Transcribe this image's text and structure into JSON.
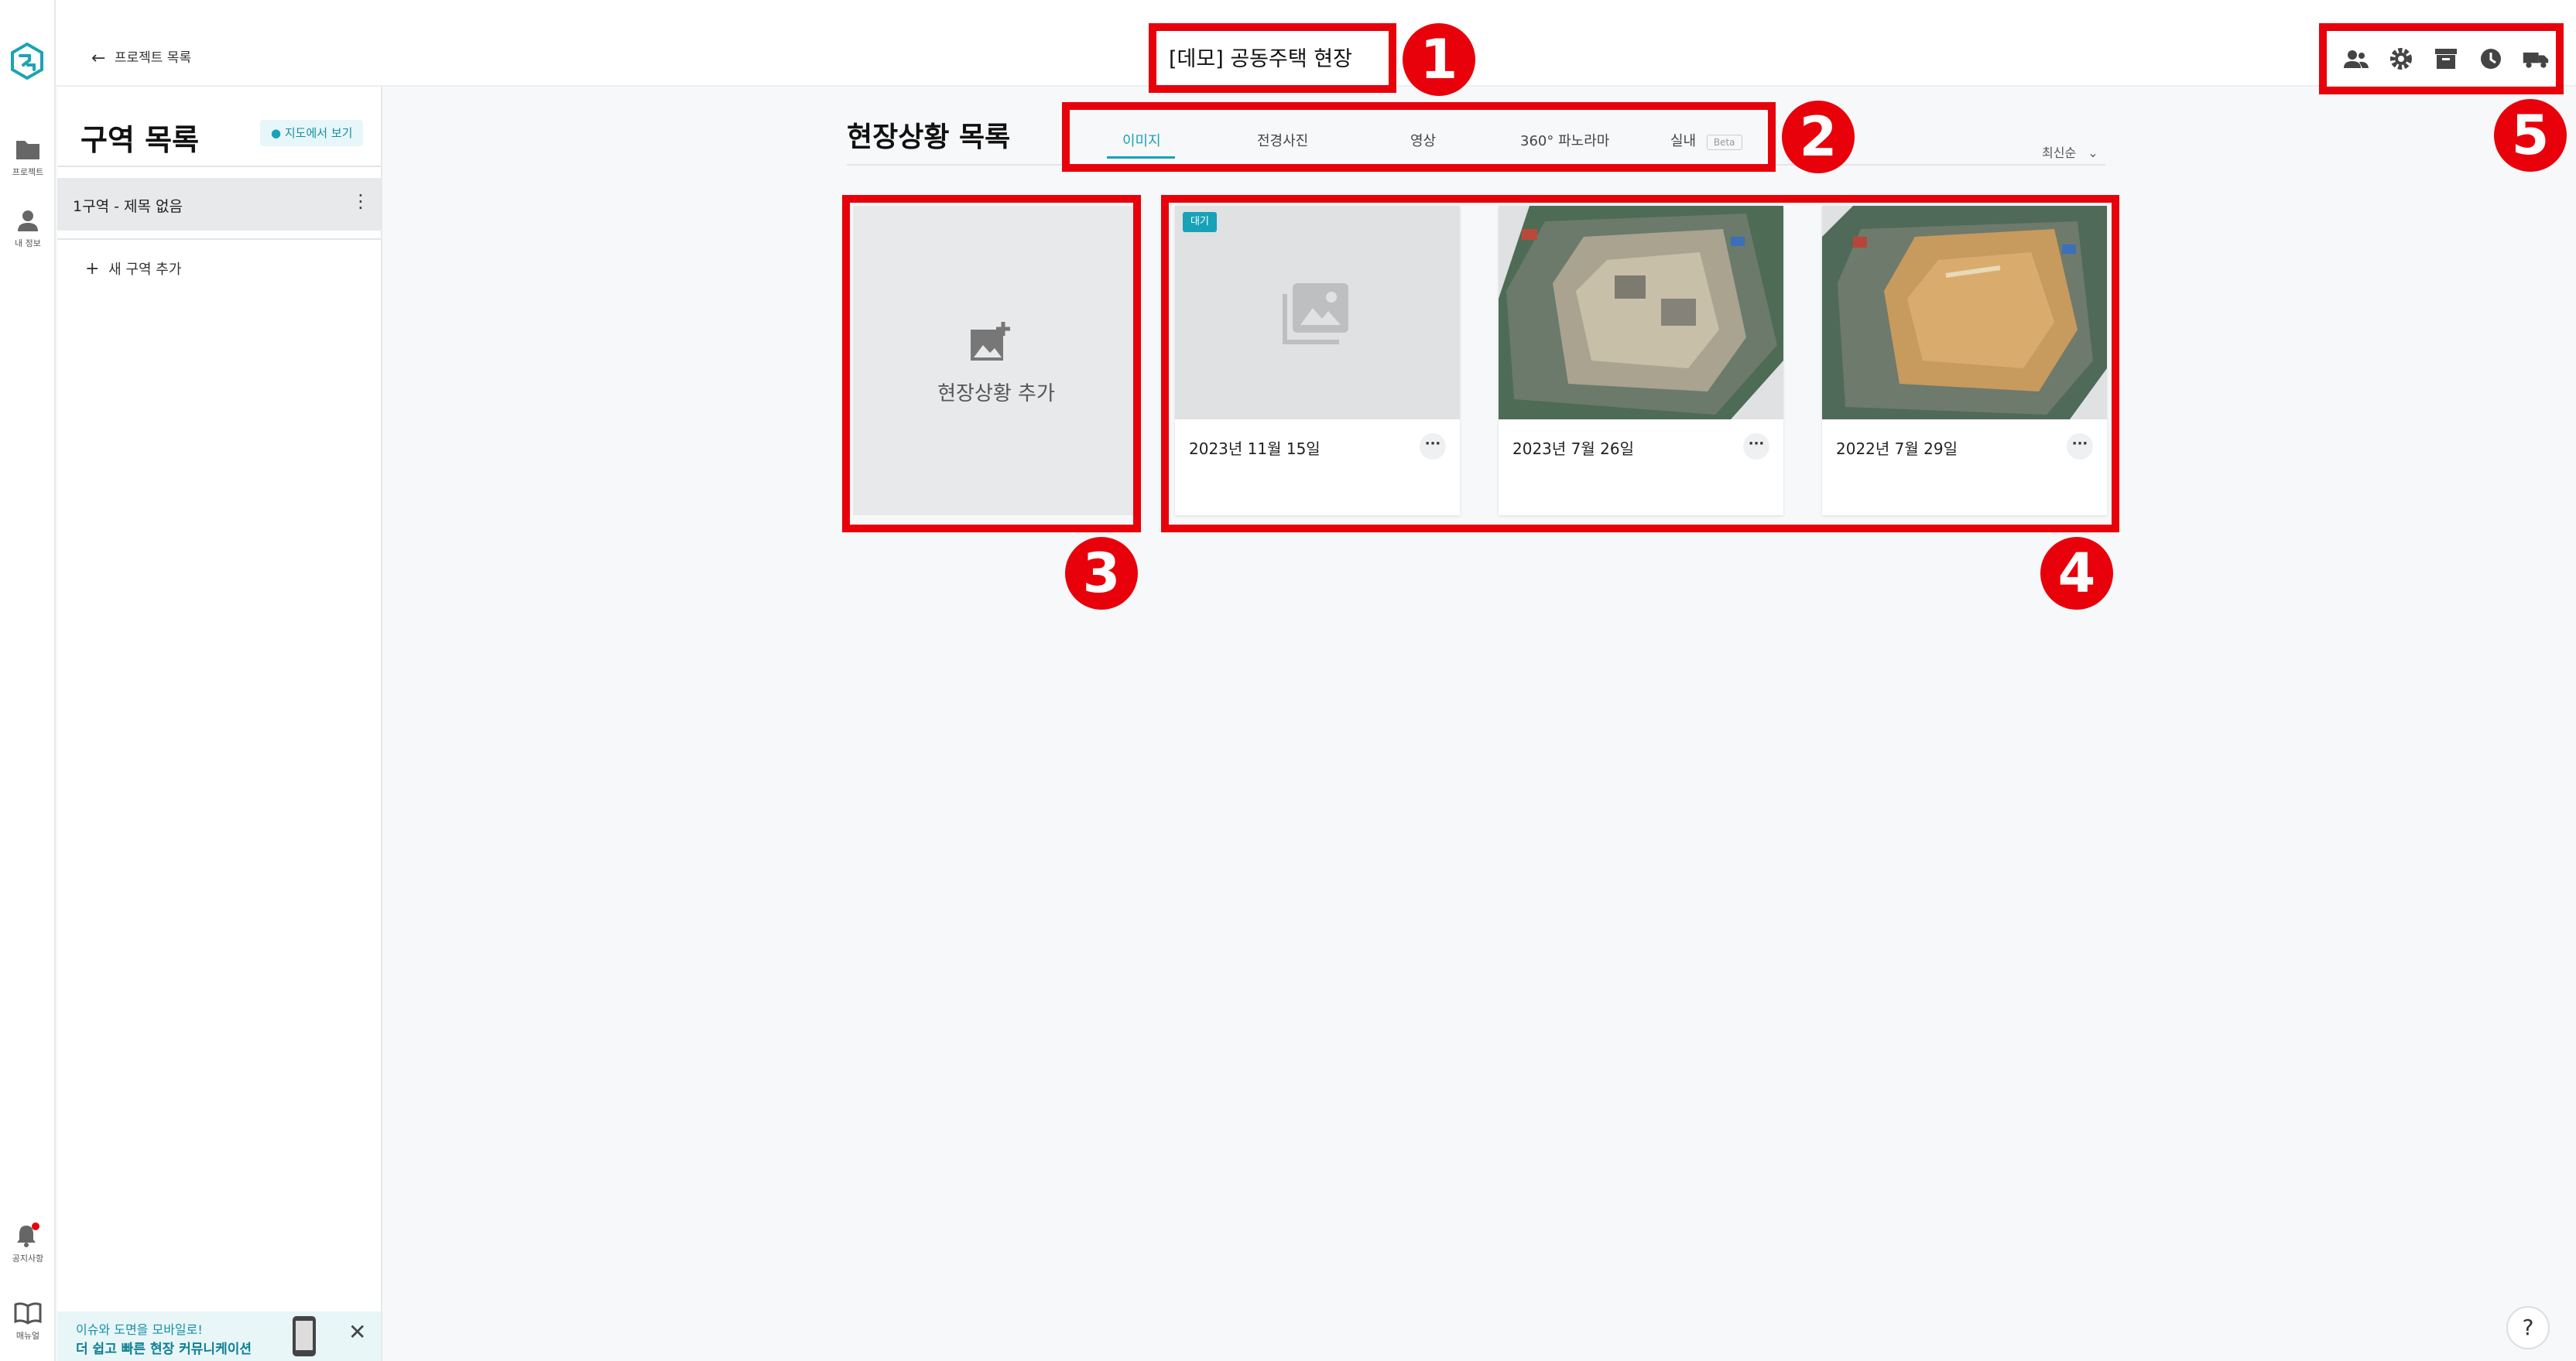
{
  "header": {
    "back_label": "프로젝트 목록",
    "project_title": "[데모] 공동주택 현장"
  },
  "rail": {
    "items": [
      {
        "label": "프로젝트",
        "icon": "folder-icon"
      },
      {
        "label": "내 정보",
        "icon": "person-icon"
      },
      {
        "label": "공지사항",
        "icon": "bell-icon"
      },
      {
        "label": "매뉴얼",
        "icon": "book-icon"
      }
    ]
  },
  "sidebar": {
    "title": "구역 목록",
    "map_button": "지도에서 보기",
    "zones": [
      {
        "label": "1구역 - 제목 없음"
      }
    ],
    "add_zone": "새 구역 추가",
    "promo": {
      "line1": "이슈와 도면을 모바일로!",
      "line2": "더 쉽고 빠른 현장 커뮤니케이션"
    }
  },
  "main": {
    "title": "현장상황 목록",
    "tabs": [
      {
        "label": "이미지",
        "active": true
      },
      {
        "label": "전경사진",
        "active": false
      },
      {
        "label": "영상",
        "active": false
      },
      {
        "label": "360° 파노라마",
        "active": false
      },
      {
        "label": "실내",
        "active": false,
        "badge": "Beta"
      }
    ],
    "sort": "최신순",
    "add_card_label": "현장상황 추가",
    "cards": [
      {
        "date": "2023년 11월 15일",
        "badge": "대기",
        "placeholder": true
      },
      {
        "date": "2023년 7월 26일",
        "badge": "",
        "placeholder": false
      },
      {
        "date": "2022년 7월 29일",
        "badge": "",
        "placeholder": false
      }
    ]
  },
  "annotations": [
    "1",
    "2",
    "3",
    "4",
    "5"
  ],
  "help_label": "?",
  "colors": {
    "accent": "#17a2b8",
    "annotation": "#e8000b",
    "badge_bg": "#17a2b8"
  }
}
